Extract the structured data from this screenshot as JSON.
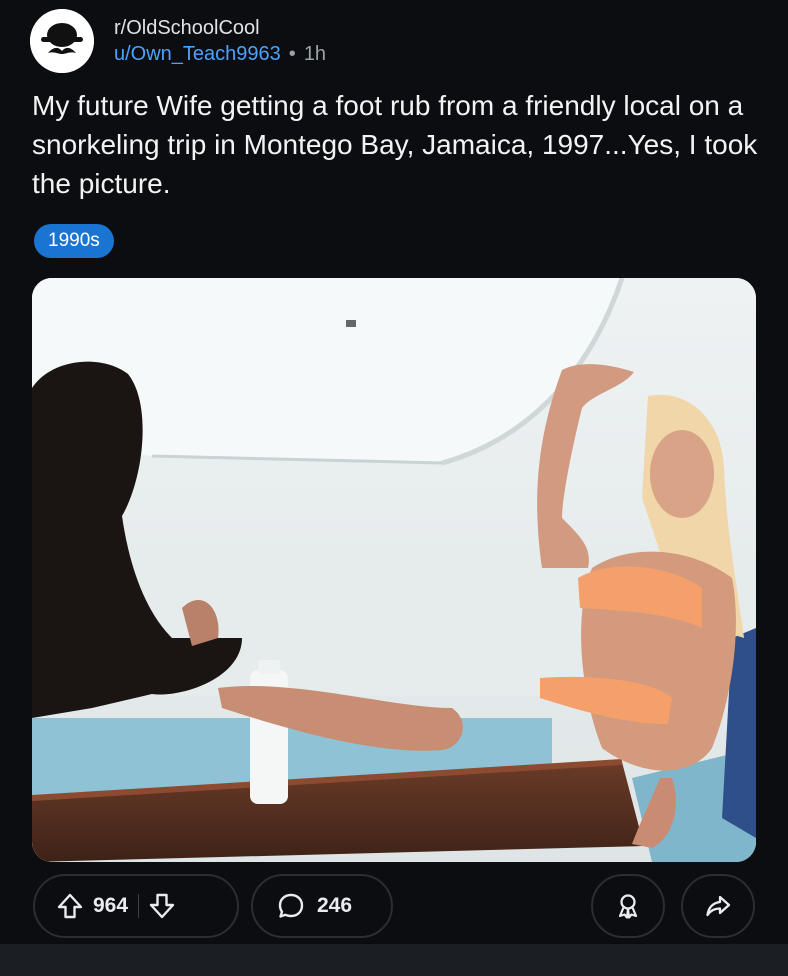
{
  "post": {
    "subreddit": "r/OldSchoolCool",
    "author": "u/Own_Teach9963",
    "separator": "•",
    "age": "1h",
    "title": "My future Wife getting a foot rub from a friendly local on a snorkeling trip in  Montego Bay, Jamaica, 1997...Yes, I took the picture.",
    "flair": "1990s",
    "flair_color": "#1a75d2"
  },
  "actions": {
    "upvotes": "964",
    "comments": "246"
  },
  "icons": {
    "avatar": "bowler-hat-mustache-avatar",
    "upvote": "arrow-up-icon",
    "downvote": "arrow-down-icon",
    "comment": "speech-bubble-icon",
    "award": "award-icon",
    "share": "share-arrow-icon"
  },
  "colors": {
    "background": "#0b0d10",
    "link": "#4aa3ff",
    "text": "#e8ecef"
  }
}
